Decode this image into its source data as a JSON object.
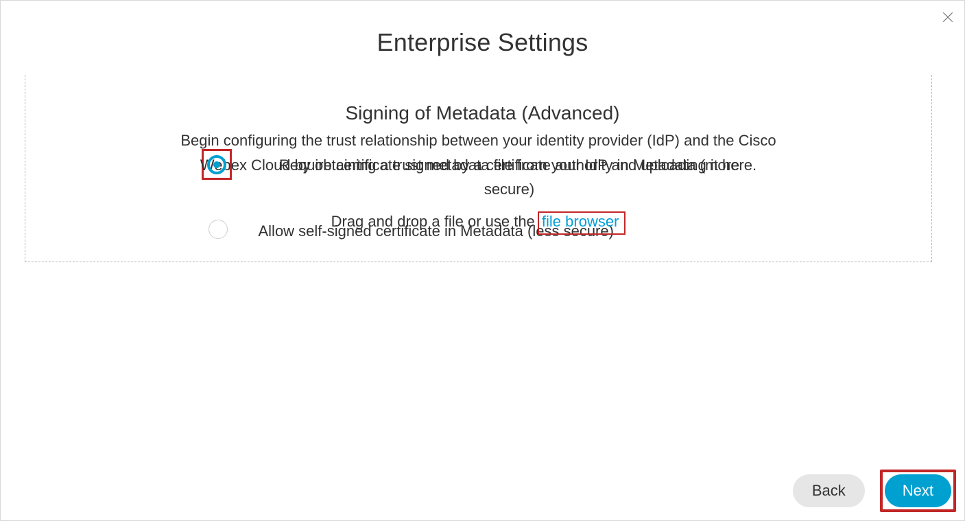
{
  "title": "Enterprise Settings",
  "dropzone": {
    "intro": "Begin configuring the trust relationship between your identity provider (IdP) and the Cisco Webex Cloud by obtaining a trust metadata file from your IdP and uploading it here.",
    "action_prefix": "Drag and drop a file or use the ",
    "file_browser_label": "file browser"
  },
  "section": {
    "title": "Signing of Metadata (Advanced)",
    "options": [
      {
        "label": "Require certificate signed by a certificate authority in Metadata (more secure)",
        "selected": true
      },
      {
        "label": "Allow self-signed certificate in Metadata (less secure)",
        "selected": false
      }
    ]
  },
  "buttons": {
    "back": "Back",
    "next": "Next"
  }
}
